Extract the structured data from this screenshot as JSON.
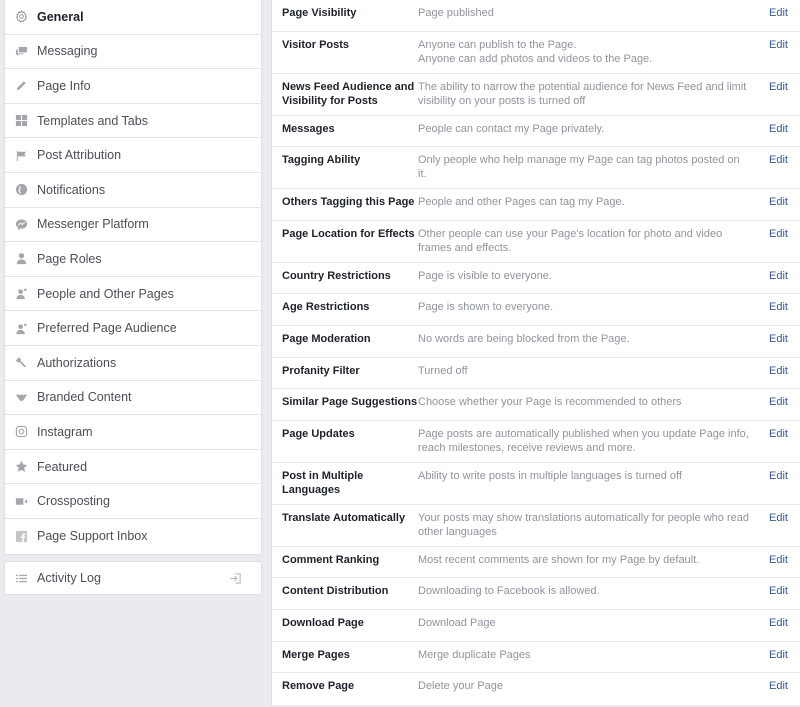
{
  "sidebar": {
    "items": [
      {
        "label": "General",
        "icon": "gear-icon",
        "active": true
      },
      {
        "label": "Messaging",
        "icon": "chat-bubbles-icon"
      },
      {
        "label": "Page Info",
        "icon": "pencil-icon"
      },
      {
        "label": "Templates and Tabs",
        "icon": "grid-icon"
      },
      {
        "label": "Post Attribution",
        "icon": "flag-icon"
      },
      {
        "label": "Notifications",
        "icon": "globe-icon"
      },
      {
        "label": "Messenger Platform",
        "icon": "messenger-icon"
      },
      {
        "label": "Page Roles",
        "icon": "person-icon"
      },
      {
        "label": "People and Other Pages",
        "icon": "person-star-icon"
      },
      {
        "label": "Preferred Page Audience",
        "icon": "person-star-icon"
      },
      {
        "label": "Authorizations",
        "icon": "wrench-icon"
      },
      {
        "label": "Branded Content",
        "icon": "handshake-icon"
      },
      {
        "label": "Instagram",
        "icon": "instagram-icon"
      },
      {
        "label": "Featured",
        "icon": "star-icon"
      },
      {
        "label": "Crossposting",
        "icon": "video-camera-icon"
      },
      {
        "label": "Page Support Inbox",
        "icon": "facebook-icon"
      }
    ],
    "activity_log": {
      "label": "Activity Log",
      "icon": "list-icon",
      "action_icon": "sign-in-icon"
    }
  },
  "settings": {
    "edit_label": "Edit",
    "rows": [
      {
        "label": "Page Visibility",
        "value": [
          "Page published"
        ]
      },
      {
        "label": "Visitor Posts",
        "value": [
          "Anyone can publish to the Page.",
          "Anyone can add photos and videos to the Page."
        ]
      },
      {
        "label": "News Feed Audience and Visibility for Posts",
        "value": [
          "The ability to narrow the potential audience for News Feed and limit visibility on your posts is turned off"
        ]
      },
      {
        "label": "Messages",
        "value": [
          "People can contact my Page privately."
        ]
      },
      {
        "label": "Tagging Ability",
        "value": [
          "Only people who help manage my Page can tag photos posted on it."
        ]
      },
      {
        "label": "Others Tagging this Page",
        "value": [
          "People and other Pages can tag my Page."
        ]
      },
      {
        "label": "Page Location for Effects",
        "value": [
          "Other people can use your Page's location for photo and video frames and effects."
        ]
      },
      {
        "label": "Country Restrictions",
        "value": [
          "Page is visible to everyone."
        ]
      },
      {
        "label": "Age Restrictions",
        "value": [
          "Page is shown to everyone."
        ]
      },
      {
        "label": "Page Moderation",
        "value": [
          "No words are being blocked from the Page."
        ]
      },
      {
        "label": "Profanity Filter",
        "value": [
          "Turned off"
        ]
      },
      {
        "label": "Similar Page Suggestions",
        "value": [
          "Choose whether your Page is recommended to others"
        ]
      },
      {
        "label": "Page Updates",
        "value": [
          "Page posts are automatically published when you update Page info, reach milestones, receive reviews and more."
        ]
      },
      {
        "label": "Post in Multiple Languages",
        "value": [
          "Ability to write posts in multiple languages is turned off"
        ]
      },
      {
        "label": "Translate Automatically",
        "value": [
          "Your posts may show translations automatically for people who read other languages"
        ]
      },
      {
        "label": "Comment Ranking",
        "value": [
          "Most recent comments are shown for my Page by default."
        ]
      },
      {
        "label": "Content Distribution",
        "value": [
          "Downloading to Facebook is allowed."
        ]
      },
      {
        "label": "Download Page",
        "value": [
          "Download Page"
        ]
      },
      {
        "label": "Merge Pages",
        "value": [
          "Merge duplicate Pages"
        ]
      },
      {
        "label": "Remove Page",
        "value": [
          "Delete your Page"
        ]
      }
    ]
  },
  "colors": {
    "link": "#365899",
    "muted_text": "#90949c",
    "background": "#e9ebee"
  }
}
